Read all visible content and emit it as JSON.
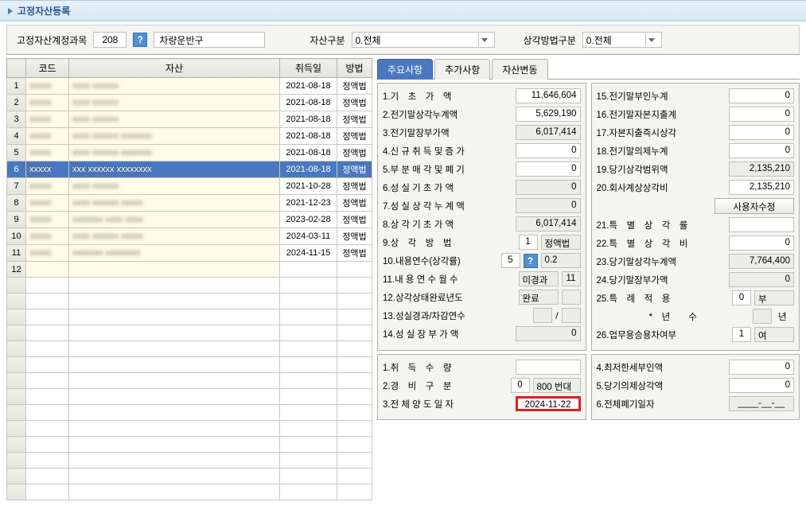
{
  "header": {
    "title": "고정자산등록"
  },
  "filter": {
    "acct_label": "고정자산계정과목",
    "acct_code": "208",
    "acct_name": "차량운반구",
    "asset_type_label": "자산구분",
    "asset_type_value": "0.전체",
    "depr_method_label": "상각방법구분",
    "depr_method_value": "0.전체"
  },
  "grid": {
    "headers": {
      "code": "코드",
      "asset": "자산",
      "date": "취득일",
      "method": "방법"
    },
    "rows": [
      {
        "n": "1",
        "code": "xxxxx",
        "asset": "xxxx  xxxxxx",
        "date": "2021-08-18",
        "method": "정액법",
        "sel": false
      },
      {
        "n": "2",
        "code": "xxxxx",
        "asset": "xxxx  xxxxxx",
        "date": "2021-08-18",
        "method": "정액법",
        "sel": false
      },
      {
        "n": "3",
        "code": "xxxxx",
        "asset": "xxxx  xxxxxx",
        "date": "2021-08-18",
        "method": "정액법",
        "sel": false
      },
      {
        "n": "4",
        "code": "xxxxx",
        "asset": "xxxx  xxxxxx  xxxxxxx",
        "date": "2021-08-18",
        "method": "정액법",
        "sel": false
      },
      {
        "n": "5",
        "code": "xxxxx",
        "asset": "xxxx  xxxxxx  xxxxxxx",
        "date": "2021-08-18",
        "method": "정액법",
        "sel": false
      },
      {
        "n": "6",
        "code": "xxxxx",
        "asset": "xxx xxxxxx  xxxxxxxx",
        "date": "2021-08-18",
        "method": "정액법",
        "sel": true
      },
      {
        "n": "7",
        "code": "xxxxx",
        "asset": "xxxx  xxxxxx",
        "date": "2021-10-28",
        "method": "정액법",
        "sel": false
      },
      {
        "n": "8",
        "code": "xxxxx",
        "asset": "xxxx  xxxxxx  xxxxx",
        "date": "2021-12-23",
        "method": "정액법",
        "sel": false
      },
      {
        "n": "9",
        "code": "xxxxx",
        "asset": "xxxxxxx xxxx xxxx",
        "date": "2023-02-28",
        "method": "정액법",
        "sel": false
      },
      {
        "n": "10",
        "code": "xxxxx",
        "asset": "xxxx  xxxxxx  xxxxx",
        "date": "2024-03-11",
        "method": "정액법",
        "sel": false
      },
      {
        "n": "11",
        "code": "xxxxx",
        "asset": "xxxxxxx xxxxxxxx",
        "date": "2024-11-15",
        "method": "정액법",
        "sel": false
      },
      {
        "n": "12",
        "code": "",
        "asset": "",
        "date": "",
        "method": "",
        "sel": false
      }
    ],
    "blank_rows": 14
  },
  "tabs": {
    "main": "주요사항",
    "extra": "추가사항",
    "change": "자산변동"
  },
  "left_fields": [
    {
      "num": "1.",
      "label": "기　초　가　액",
      "val": "11,646,604"
    },
    {
      "num": "2.",
      "label": "전기말상각누계액",
      "val": "5,629,190"
    },
    {
      "num": "3.",
      "label": "전기말장부가액",
      "val": "6,017,414",
      "ro": true
    },
    {
      "num": "4.",
      "label": "신 규 취 득 및 증 가",
      "val": "0"
    },
    {
      "num": "5.",
      "label": "부 분 매 각 및 폐 기",
      "val": "0"
    },
    {
      "num": "6.",
      "label": "성 실 기 초 가 액",
      "val": "0",
      "ro": true
    },
    {
      "num": "7.",
      "label": "성 실 상 각 누 계 액",
      "val": "0",
      "ro": true
    },
    {
      "num": "8.",
      "label": "상 각 기 초 가 액",
      "val": "6,017,414",
      "ro": true
    }
  ],
  "method_row": {
    "num": "9.",
    "label": "상　각　방　법",
    "code": "1",
    "name": "정액법"
  },
  "life_row": {
    "num": "10.",
    "label": "내용연수(상각률)",
    "years": "5",
    "rate": "0.2"
  },
  "months_row": {
    "num": "11.",
    "label": "내 용 연 수 월 수",
    "status": "미경과",
    "months": "11"
  },
  "complete_row": {
    "num": "12.",
    "label": "상각상태완료년도",
    "val": "완료"
  },
  "diff_row": {
    "num": "13.",
    "label": "성실경과/차감연수",
    "sep": "/"
  },
  "book_row": {
    "num": "14.",
    "label": "성 실 장 부 가 액",
    "val": "0"
  },
  "right_fields": [
    {
      "num": "15.",
      "label": "전기말부인누계",
      "val": "0"
    },
    {
      "num": "16.",
      "label": "전기말자본지출계",
      "val": "0"
    },
    {
      "num": "17.",
      "label": "자본지출즉시상각",
      "val": "0"
    },
    {
      "num": "18.",
      "label": "전기말의제누계",
      "val": "0"
    },
    {
      "num": "19.",
      "label": "당기상각범위액",
      "val": "2,135,210",
      "ro": true
    },
    {
      "num": "20.",
      "label": "회사계상상각비",
      "val": "2,135,210"
    }
  ],
  "user_edit_btn": "사용자수정",
  "right_fields2": [
    {
      "num": "21.",
      "label": "특　별　상　각　률",
      "val": ""
    },
    {
      "num": "22.",
      "label": "특　별　상　각　비",
      "val": "0"
    },
    {
      "num": "23.",
      "label": "당기말상각누계액",
      "val": "7,764,400",
      "ro": true
    },
    {
      "num": "24.",
      "label": "당기말장부가액",
      "val": "0",
      "ro": true
    }
  ],
  "special_row": {
    "num": "25.",
    "label": "특　례　적　용",
    "code": "0",
    "name": "부"
  },
  "years_row": {
    "star": "*",
    "label": "년　　수",
    "unit": "년"
  },
  "biz_row": {
    "num": "26.",
    "label": "업무용승용차여부",
    "code": "1",
    "name": "여"
  },
  "bottom_left": {
    "qty": {
      "num": "1.",
      "label": "취　득　수　량",
      "val": ""
    },
    "exp": {
      "num": "2.",
      "label": "경　비　구　분",
      "code": "0",
      "name": "800 번대"
    },
    "trans": {
      "num": "3.",
      "label": "전 체 양 도 일 자",
      "val": "2024-11-22"
    }
  },
  "bottom_right": {
    "min": {
      "num": "4.",
      "label": "최저한세부인액",
      "val": "0"
    },
    "curr": {
      "num": "5.",
      "label": "당기의제상각액",
      "val": "0"
    },
    "disp": {
      "num": "6.",
      "label": "전체폐기일자",
      "val": "____-__-__"
    }
  }
}
